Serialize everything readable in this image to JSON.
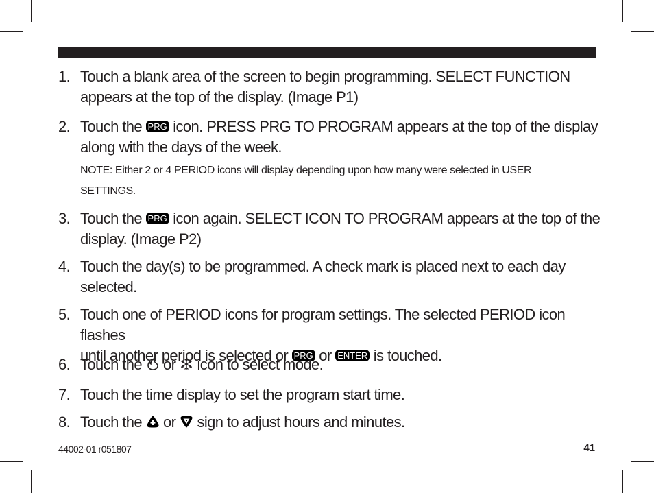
{
  "steps": [
    {
      "num": "1.",
      "lines": [
        "Touch a blank area of the screen to begin programming. SELECT FUNCTION",
        "appears at the top of the display. (Image P1)"
      ]
    },
    {
      "num": "2.",
      "pre": "Touch the",
      "key": "PRG",
      "post": "icon. PRESS PRG TO PROGRAM appears at the top of the display",
      "line2": "along with the days of the week."
    },
    {
      "num": "3.",
      "pre": "Touch the",
      "key": "PRG",
      "post": "icon again. SELECT ICON TO PROGRAM appears at the top of the",
      "line2": "display. (Image P2)"
    },
    {
      "num": "4.",
      "lines": [
        "Touch the day(s) to be programmed. A check mark is placed next to each day",
        "selected."
      ]
    },
    {
      "num": "5.",
      "line1": "Touch one of PERIOD icons for program settings. The selected PERIOD icon flashes",
      "pre": "until another period is selected or",
      "key1": "PRG",
      "mid": "or",
      "key2": "ENTER",
      "post": "is touched."
    },
    {
      "num": "6.",
      "pre": "Touch the",
      "icon1": "flame-icon",
      "mid": "or",
      "icon2": "snowflake-icon",
      "post": "icon to select mode."
    },
    {
      "num": "7.",
      "text": "Touch the time display to set the program start time."
    },
    {
      "num": "8.",
      "pre": "Touch the",
      "icon1": "up-arrow-icon",
      "mid": "or",
      "icon2": "down-arrow-icon",
      "post": "sign to adjust hours and minutes."
    }
  ],
  "note": {
    "line1": "NOTE: Either 2 or 4 PERIOD icons will display depending upon how many were selected in USER",
    "line2": "SETTINGS."
  },
  "footer": {
    "doc_id": "44002-01 r051807",
    "page_number": "41"
  }
}
